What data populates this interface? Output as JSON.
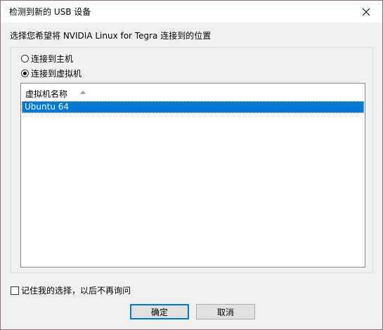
{
  "window": {
    "title": "检测到新的 USB 设备",
    "close_icon": "close-icon"
  },
  "prompt": "选择您希望将 NVIDIA Linux for Tegra 连接到的位置",
  "options": {
    "host_label": "连接到主机",
    "vm_label": "连接到虚拟机",
    "selected": "vm"
  },
  "vm_list": {
    "column_header": "虚拟机名称",
    "sort": "ascending",
    "rows": [
      "Ubuntu 64"
    ],
    "selected_index": 0
  },
  "remember_label": "记住我的选择，以后不再询问",
  "remember_checked": false,
  "buttons": {
    "ok": "确定",
    "cancel": "取消"
  },
  "colors": {
    "selection": "#0078d7",
    "dialog_bg": "#f0f0f0"
  }
}
